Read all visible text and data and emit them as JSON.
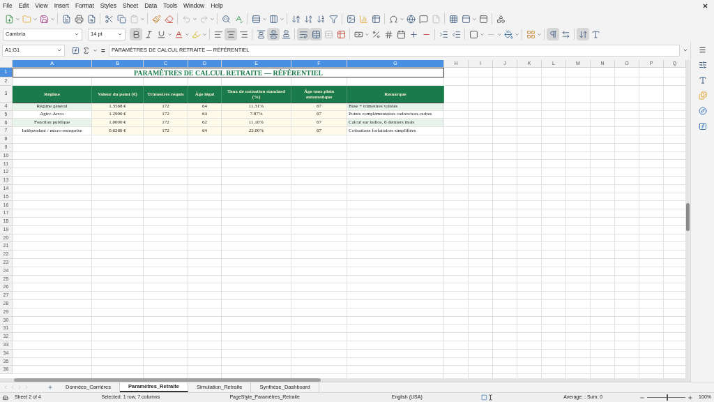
{
  "menu": [
    "File",
    "Edit",
    "View",
    "Insert",
    "Format",
    "Styles",
    "Sheet",
    "Data",
    "Tools",
    "Window",
    "Help"
  ],
  "format_bar": {
    "font_name": "Cambria",
    "font_size": "14 pt",
    "bold": true,
    "italic": false,
    "underline": false,
    "align_left": false,
    "align_center": true,
    "align_right": false,
    "align_top": false,
    "align_middle": true,
    "align_bottom": false,
    "wrap_text": true,
    "merge_cells": true,
    "left_to_right": true,
    "right_to_left": false,
    "text_direction": true
  },
  "formula_bar": {
    "name_box": "A1:G1",
    "equals_symbol": "=",
    "content": "PARAMÈTRES DE CALCUL RETRAITE — RÉFÉRENTIEL"
  },
  "columns": [
    {
      "label": "A",
      "selected": true
    },
    {
      "label": "B",
      "selected": true
    },
    {
      "label": "C",
      "selected": true
    },
    {
      "label": "D",
      "selected": true
    },
    {
      "label": "E",
      "selected": true
    },
    {
      "label": "F",
      "selected": true
    },
    {
      "label": "G",
      "selected": true
    },
    {
      "label": "H",
      "selected": false
    },
    {
      "label": "I",
      "selected": false
    },
    {
      "label": "J",
      "selected": false
    },
    {
      "label": "K",
      "selected": false
    },
    {
      "label": "L",
      "selected": false
    },
    {
      "label": "M",
      "selected": false
    },
    {
      "label": "N",
      "selected": false
    },
    {
      "label": "O",
      "selected": false
    },
    {
      "label": "P",
      "selected": false
    },
    {
      "label": "Q",
      "selected": false
    }
  ],
  "rows": [
    {
      "label": "1",
      "selected": true
    },
    {
      "label": "2",
      "selected": false
    },
    {
      "label": "3",
      "selected": false
    },
    {
      "label": "4",
      "selected": false
    },
    {
      "label": "5",
      "selected": false
    },
    {
      "label": "6",
      "selected": false
    },
    {
      "label": "7",
      "selected": false
    },
    {
      "label": "8",
      "selected": false
    },
    {
      "label": "9",
      "selected": false
    },
    {
      "label": "10",
      "selected": false
    },
    {
      "label": "11",
      "selected": false
    },
    {
      "label": "12",
      "selected": false
    },
    {
      "label": "13",
      "selected": false
    },
    {
      "label": "14",
      "selected": false
    },
    {
      "label": "15",
      "selected": false
    },
    {
      "label": "16",
      "selected": false
    },
    {
      "label": "17",
      "selected": false
    },
    {
      "label": "18",
      "selected": false
    },
    {
      "label": "19",
      "selected": false
    },
    {
      "label": "20",
      "selected": false
    },
    {
      "label": "21",
      "selected": false
    },
    {
      "label": "22",
      "selected": false
    },
    {
      "label": "23",
      "selected": false
    },
    {
      "label": "24",
      "selected": false
    },
    {
      "label": "25",
      "selected": false
    },
    {
      "label": "26",
      "selected": false
    },
    {
      "label": "27",
      "selected": false
    },
    {
      "label": "28",
      "selected": false
    },
    {
      "label": "29",
      "selected": false
    },
    {
      "label": "30",
      "selected": false
    },
    {
      "label": "31",
      "selected": false
    },
    {
      "label": "32",
      "selected": false
    },
    {
      "label": "33",
      "selected": false
    },
    {
      "label": "34",
      "selected": false
    },
    {
      "label": "35",
      "selected": false
    },
    {
      "label": "36",
      "selected": false
    }
  ],
  "sheet": {
    "title": "PARAMÈTRES DE CALCUL RETRAITE — RÉFÉRENTIEL",
    "headers": [
      "Régime",
      "Valeur du point (€)",
      "Trimestres requis",
      "Âge légal",
      "Taux de cotisation standard (%)",
      "Âge taux plein automatique",
      "Remarque"
    ],
    "data": [
      {
        "banded": true,
        "cells": [
          "Régime général",
          "1.3568 €",
          "172",
          "64",
          "11.31%",
          "67",
          "Base + trimestres validés"
        ]
      },
      {
        "banded": false,
        "cells": [
          "Agirc-Arrco",
          "1.2900 €",
          "172",
          "64",
          "7.87%",
          "67",
          "Points complémentaires cadres/non-cadres"
        ]
      },
      {
        "banded": true,
        "cells": [
          "Fonction publique",
          "1.0000 €",
          "172",
          "62",
          "11.10%",
          "67",
          "Calcul sur indice, 6 derniers mois"
        ]
      },
      {
        "banded": false,
        "cells": [
          "Indépendant / micro-entreprise",
          "0.6260 €",
          "172",
          "64",
          "22.00%",
          "67",
          "Cotisations forfaitaires simplifiées"
        ]
      }
    ]
  },
  "sheet_tabs": [
    {
      "label": "Données_Carrières",
      "selected": false
    },
    {
      "label": "Paramètres_Retraite",
      "selected": true
    },
    {
      "label": "Simulation_Retraite",
      "selected": false
    },
    {
      "label": "Synthèse_Dashboard",
      "selected": false
    }
  ],
  "status_bar": {
    "sheet": "Sheet 2 of 4",
    "selection": "Selected: 1 row, 7 columns",
    "page_style": "PageStyle_Paramètres_Retraite",
    "language": "English (USA)",
    "sum": "Average: ; Sum: 0",
    "zoom": "100%",
    "zoom_level": {
      "level": 0.5
    }
  }
}
